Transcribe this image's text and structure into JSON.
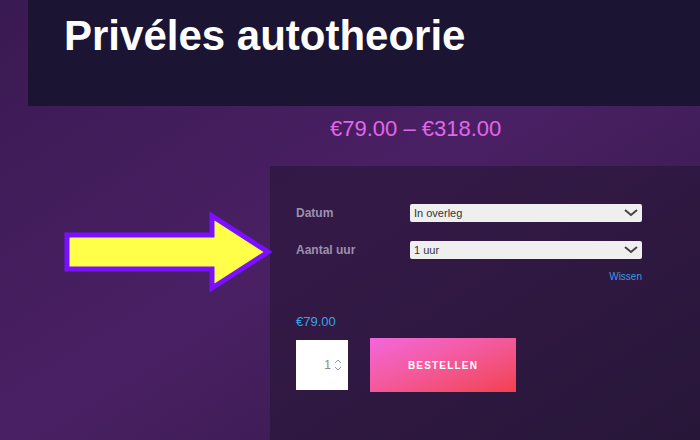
{
  "page": {
    "title": "Privéles autotheorie",
    "price_range": "€79.00 – €318.00"
  },
  "form": {
    "fields": [
      {
        "label": "Datum",
        "value": "In overleg"
      },
      {
        "label": "Aantal uur",
        "value": "1 uur"
      }
    ],
    "clear_link": "Wissen",
    "price": "€79.00",
    "quantity": "1",
    "button": "BESTELLEN"
  }
}
